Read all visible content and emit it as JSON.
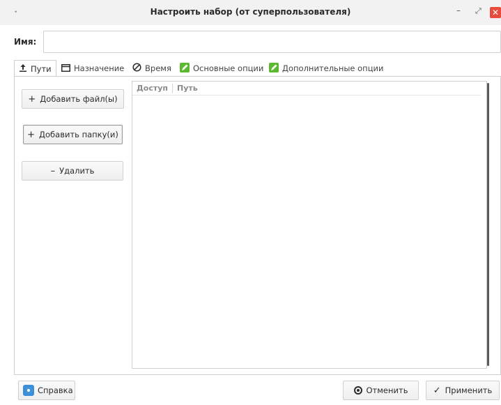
{
  "window": {
    "title": "Настроить набор (от суперпользователя)",
    "dot": "•",
    "minimize": "–",
    "maximize": "⤢",
    "close": "✕"
  },
  "name_field": {
    "label": "Имя:",
    "value": "",
    "placeholder": ""
  },
  "tabs": [
    {
      "icon": "upload-icon",
      "glyph": "⬆",
      "label": "Пути"
    },
    {
      "icon": "folder-icon",
      "glyph": "🗀",
      "label": "Назначение"
    },
    {
      "icon": "no-clock-icon",
      "glyph": "⊘",
      "label": "Время"
    },
    {
      "icon": "edit-green-icon",
      "glyph": "✎",
      "label": "Основные опции"
    },
    {
      "icon": "edit-green-icon",
      "glyph": "✎",
      "label": "Дополнительные опции"
    }
  ],
  "paths": {
    "add_files": {
      "glyph": "+",
      "label": "Добавить файл(ы)"
    },
    "add_folders": {
      "glyph": "+",
      "label": "Добавить папку(и)"
    },
    "remove": {
      "glyph": "–",
      "label": "Удалить"
    },
    "columns": [
      "Доступ",
      "Путь"
    ],
    "rows": []
  },
  "footer": {
    "help": "Справка",
    "cancel": "Отменить",
    "apply_glyph": "✓",
    "apply": "Применить"
  },
  "colors": {
    "accent_close": "#e74c3c",
    "help_blue": "#3b8fd6",
    "tab_icon_green": "#5cb82e",
    "border": "#cfcfcf"
  }
}
